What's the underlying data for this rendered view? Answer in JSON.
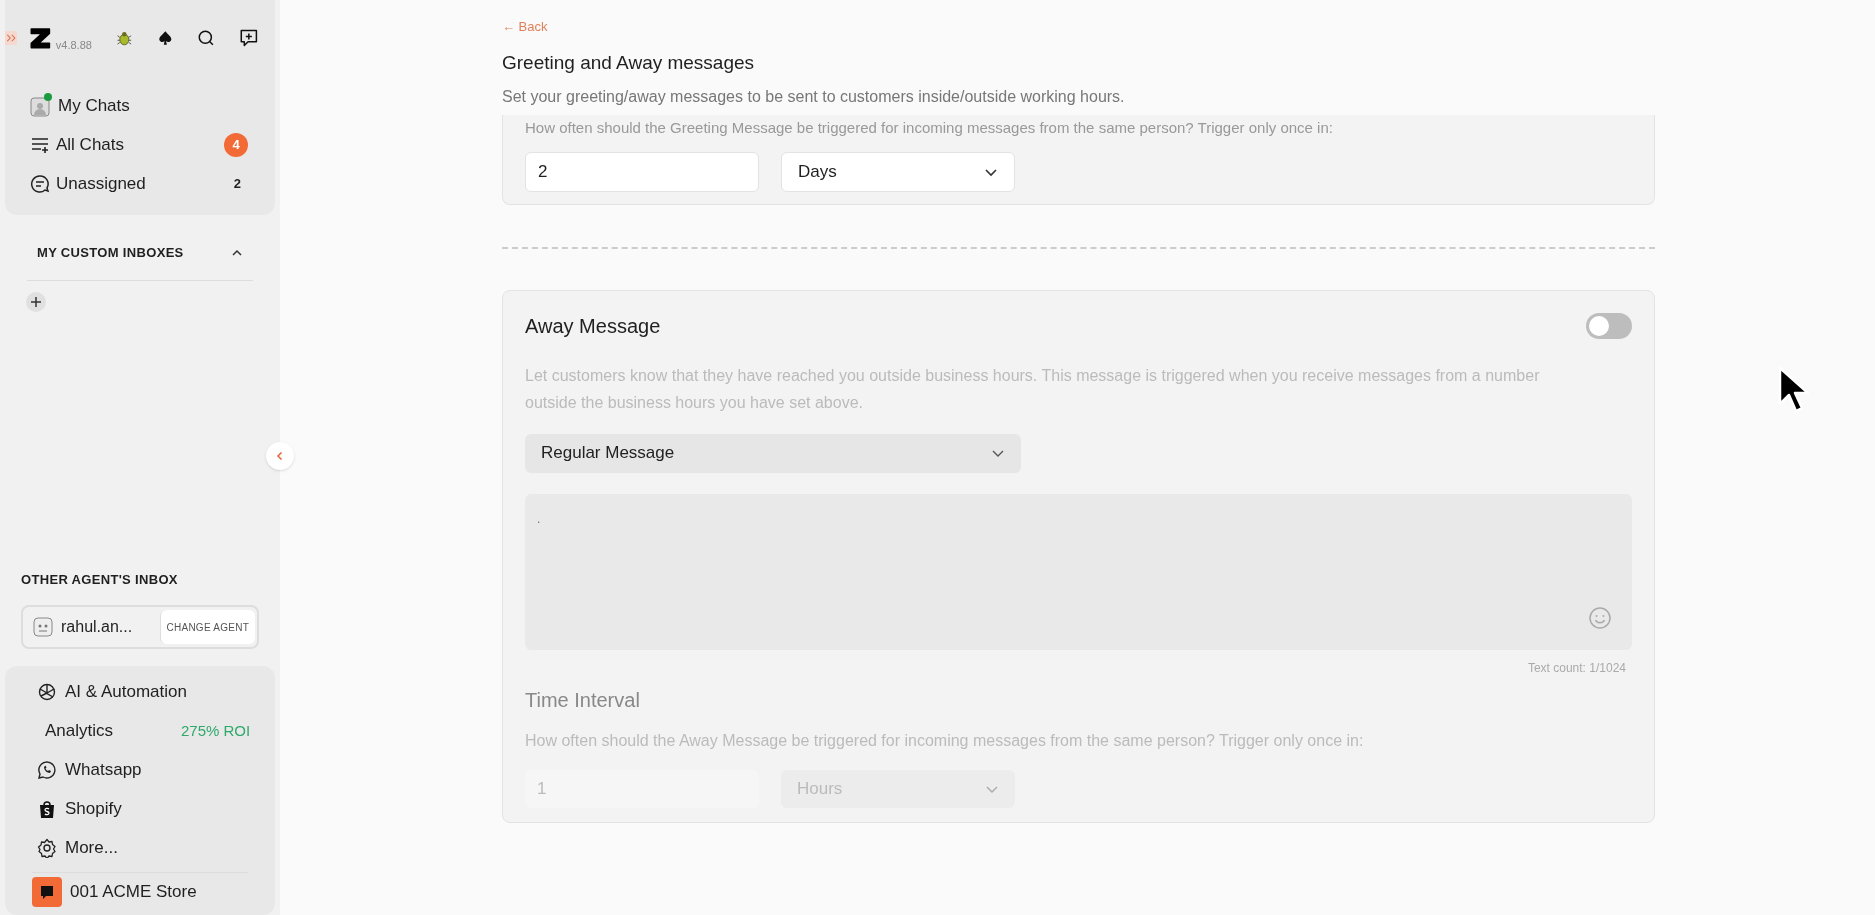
{
  "sidebar": {
    "version": "v4.8.88",
    "nav": [
      {
        "label": "My Chats",
        "online": true
      },
      {
        "label": "All Chats",
        "count": "4",
        "highlighted": true
      },
      {
        "label": "Unassigned",
        "count": "2",
        "highlighted": false
      }
    ],
    "custom_inboxes": {
      "title": "MY CUSTOM INBOXES",
      "expanded": true
    },
    "other_agent": {
      "title": "OTHER AGENT'S INBOX",
      "agent": "rahul.an...",
      "button": "CHANGE AGENT"
    },
    "tools": [
      {
        "label": "AI & Automation"
      },
      {
        "label": "Analytics",
        "tag": "275% ROI"
      },
      {
        "label": "Whatsapp"
      },
      {
        "label": "Shopify"
      },
      {
        "label": "More..."
      }
    ],
    "store": "001 ACME Store"
  },
  "main": {
    "back": "← Back",
    "title": "Greeting and Away messages",
    "subtitle": "Set your greeting/away messages to be sent to customers inside/outside working hours.",
    "greeting": {
      "question": "How often should the Greeting Message be triggered for incoming messages from the same person? Trigger only once in:",
      "interval_value": "2",
      "interval_unit": "Days"
    },
    "away": {
      "title": "Away Message",
      "enabled": false,
      "description": "Let customers know that they have reached you outside business hours. This message is triggered when you receive messages from a number outside the business hours you have set above.",
      "message_type": "Regular Message",
      "message": ".",
      "text_count": "Text count: 1/1024",
      "interval_title": "Time Interval",
      "interval_question": "How often should the Away Message be triggered for incoming messages from the same person? Trigger only once in:",
      "interval_value": "1",
      "interval_unit": "Hours"
    }
  }
}
